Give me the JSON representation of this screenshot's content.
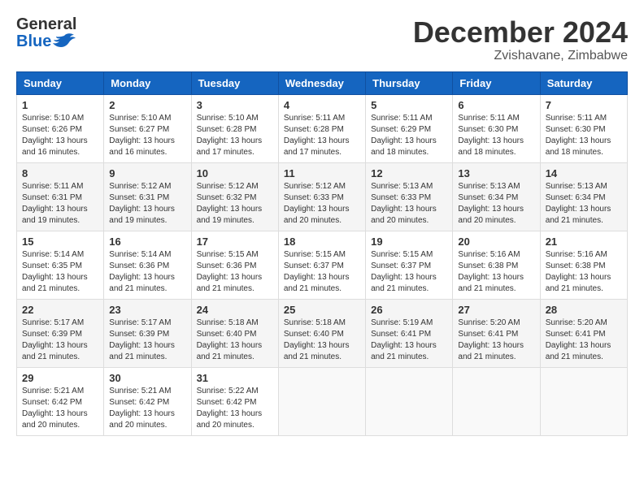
{
  "header": {
    "logo_general": "General",
    "logo_blue": "Blue",
    "month": "December 2024",
    "location": "Zvishavane, Zimbabwe"
  },
  "days_of_week": [
    "Sunday",
    "Monday",
    "Tuesday",
    "Wednesday",
    "Thursday",
    "Friday",
    "Saturday"
  ],
  "weeks": [
    [
      {
        "day": "1",
        "sunrise": "5:10 AM",
        "sunset": "6:26 PM",
        "daylight": "13 hours and 16 minutes."
      },
      {
        "day": "2",
        "sunrise": "5:10 AM",
        "sunset": "6:27 PM",
        "daylight": "13 hours and 16 minutes."
      },
      {
        "day": "3",
        "sunrise": "5:10 AM",
        "sunset": "6:28 PM",
        "daylight": "13 hours and 17 minutes."
      },
      {
        "day": "4",
        "sunrise": "5:11 AM",
        "sunset": "6:28 PM",
        "daylight": "13 hours and 17 minutes."
      },
      {
        "day": "5",
        "sunrise": "5:11 AM",
        "sunset": "6:29 PM",
        "daylight": "13 hours and 18 minutes."
      },
      {
        "day": "6",
        "sunrise": "5:11 AM",
        "sunset": "6:30 PM",
        "daylight": "13 hours and 18 minutes."
      },
      {
        "day": "7",
        "sunrise": "5:11 AM",
        "sunset": "6:30 PM",
        "daylight": "13 hours and 18 minutes."
      }
    ],
    [
      {
        "day": "8",
        "sunrise": "5:11 AM",
        "sunset": "6:31 PM",
        "daylight": "13 hours and 19 minutes."
      },
      {
        "day": "9",
        "sunrise": "5:12 AM",
        "sunset": "6:31 PM",
        "daylight": "13 hours and 19 minutes."
      },
      {
        "day": "10",
        "sunrise": "5:12 AM",
        "sunset": "6:32 PM",
        "daylight": "13 hours and 19 minutes."
      },
      {
        "day": "11",
        "sunrise": "5:12 AM",
        "sunset": "6:33 PM",
        "daylight": "13 hours and 20 minutes."
      },
      {
        "day": "12",
        "sunrise": "5:13 AM",
        "sunset": "6:33 PM",
        "daylight": "13 hours and 20 minutes."
      },
      {
        "day": "13",
        "sunrise": "5:13 AM",
        "sunset": "6:34 PM",
        "daylight": "13 hours and 20 minutes."
      },
      {
        "day": "14",
        "sunrise": "5:13 AM",
        "sunset": "6:34 PM",
        "daylight": "13 hours and 21 minutes."
      }
    ],
    [
      {
        "day": "15",
        "sunrise": "5:14 AM",
        "sunset": "6:35 PM",
        "daylight": "13 hours and 21 minutes."
      },
      {
        "day": "16",
        "sunrise": "5:14 AM",
        "sunset": "6:36 PM",
        "daylight": "13 hours and 21 minutes."
      },
      {
        "day": "17",
        "sunrise": "5:15 AM",
        "sunset": "6:36 PM",
        "daylight": "13 hours and 21 minutes."
      },
      {
        "day": "18",
        "sunrise": "5:15 AM",
        "sunset": "6:37 PM",
        "daylight": "13 hours and 21 minutes."
      },
      {
        "day": "19",
        "sunrise": "5:15 AM",
        "sunset": "6:37 PM",
        "daylight": "13 hours and 21 minutes."
      },
      {
        "day": "20",
        "sunrise": "5:16 AM",
        "sunset": "6:38 PM",
        "daylight": "13 hours and 21 minutes."
      },
      {
        "day": "21",
        "sunrise": "5:16 AM",
        "sunset": "6:38 PM",
        "daylight": "13 hours and 21 minutes."
      }
    ],
    [
      {
        "day": "22",
        "sunrise": "5:17 AM",
        "sunset": "6:39 PM",
        "daylight": "13 hours and 21 minutes."
      },
      {
        "day": "23",
        "sunrise": "5:17 AM",
        "sunset": "6:39 PM",
        "daylight": "13 hours and 21 minutes."
      },
      {
        "day": "24",
        "sunrise": "5:18 AM",
        "sunset": "6:40 PM",
        "daylight": "13 hours and 21 minutes."
      },
      {
        "day": "25",
        "sunrise": "5:18 AM",
        "sunset": "6:40 PM",
        "daylight": "13 hours and 21 minutes."
      },
      {
        "day": "26",
        "sunrise": "5:19 AM",
        "sunset": "6:41 PM",
        "daylight": "13 hours and 21 minutes."
      },
      {
        "day": "27",
        "sunrise": "5:20 AM",
        "sunset": "6:41 PM",
        "daylight": "13 hours and 21 minutes."
      },
      {
        "day": "28",
        "sunrise": "5:20 AM",
        "sunset": "6:41 PM",
        "daylight": "13 hours and 21 minutes."
      }
    ],
    [
      {
        "day": "29",
        "sunrise": "5:21 AM",
        "sunset": "6:42 PM",
        "daylight": "13 hours and 20 minutes."
      },
      {
        "day": "30",
        "sunrise": "5:21 AM",
        "sunset": "6:42 PM",
        "daylight": "13 hours and 20 minutes."
      },
      {
        "day": "31",
        "sunrise": "5:22 AM",
        "sunset": "6:42 PM",
        "daylight": "13 hours and 20 minutes."
      },
      null,
      null,
      null,
      null
    ]
  ]
}
